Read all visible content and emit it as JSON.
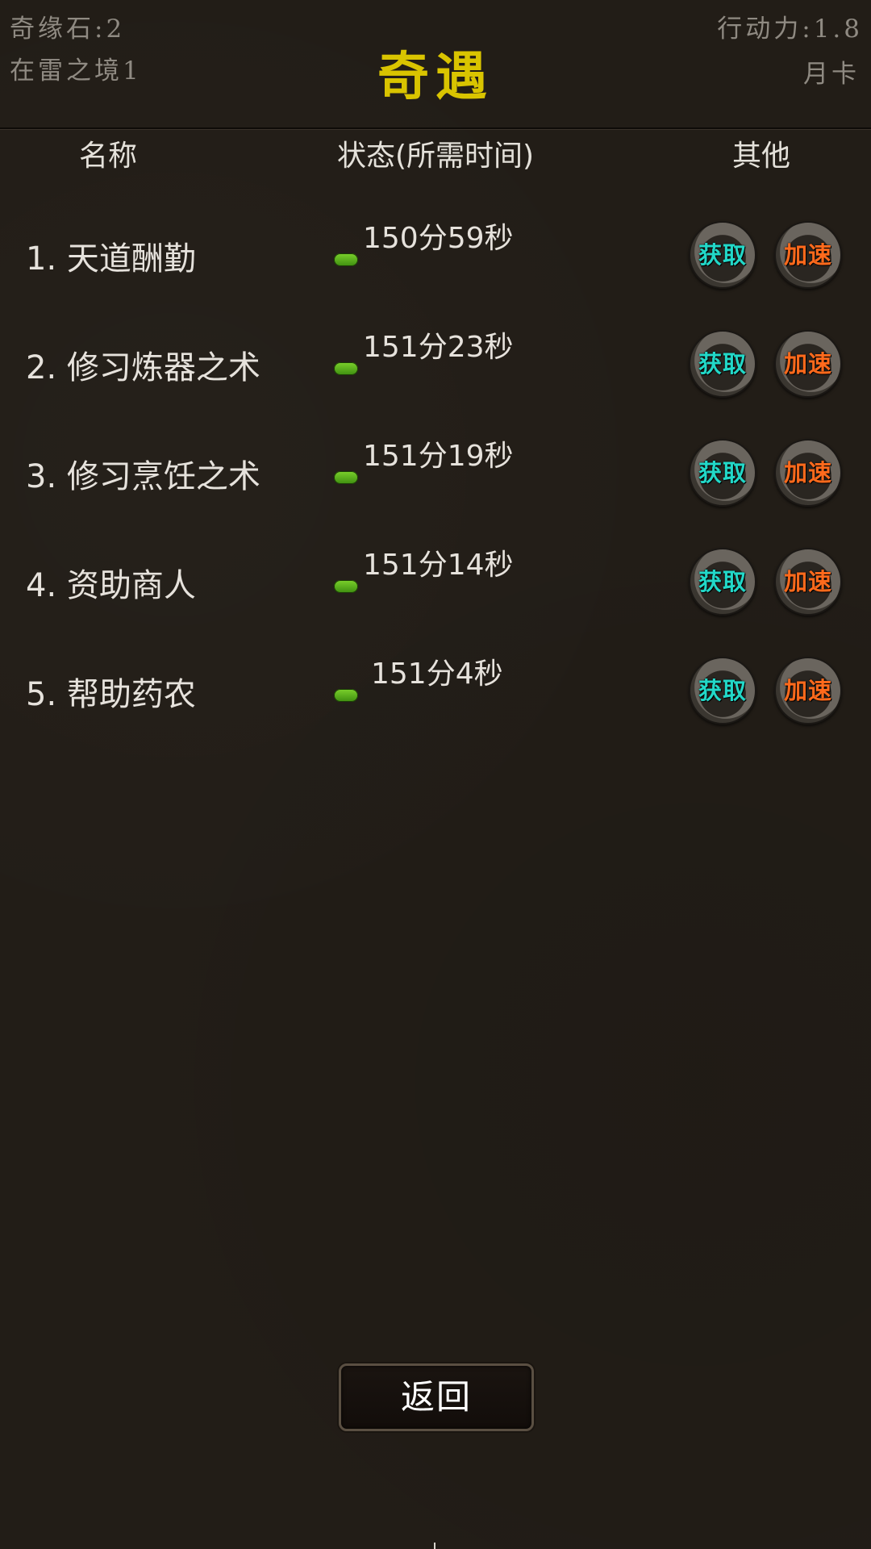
{
  "header": {
    "stone": "奇缘石:2",
    "realm": "在雷之境1",
    "title": "奇遇",
    "action_points": "行动力:1.8",
    "month_card": "月卡"
  },
  "columns": {
    "name": "名称",
    "status": "状态(所需时间)",
    "other": "其他"
  },
  "rows": [
    {
      "name": "1. 天道酬勤",
      "time": "150分59秒"
    },
    {
      "name": "2. 修习炼器之术",
      "time": "151分23秒"
    },
    {
      "name": "3. 修习烹饪之术",
      "time": "151分19秒"
    },
    {
      "name": "4. 资助商人",
      "time": "151分14秒"
    },
    {
      "name": "5. 帮助药农",
      "time": "151分4秒"
    }
  ],
  "buttons": {
    "get": "获取",
    "speed_up": "加速",
    "back": "返回"
  },
  "colors": {
    "title": "#d9c400",
    "get_text": "#22d8c8",
    "speed_text": "#ff6a1c",
    "progress": "#5cb31e",
    "background": "#221d17"
  },
  "icons": {
    "progress": "progress-bar-icon",
    "button_frame": "ink-circle-icon"
  }
}
